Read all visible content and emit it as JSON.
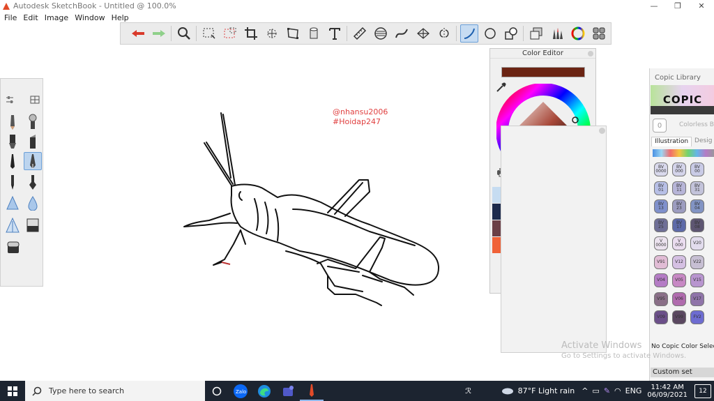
{
  "window": {
    "title": "Autodesk SketchBook - Untitled @ 100.0%",
    "minimize": "—",
    "maximize": "❐",
    "close": "✕"
  },
  "menu": [
    "File",
    "Edit",
    "Image",
    "Window",
    "Help"
  ],
  "toolbar": {
    "icons": [
      "undo-icon",
      "redo-icon",
      "zoom-icon",
      "select-icon",
      "lasso-icon",
      "crop-icon",
      "transform-icon",
      "distort-icon",
      "fill-icon",
      "text-icon",
      "ruler-icon",
      "ellipse-guide-icon",
      "french-curve-icon",
      "perspective-icon",
      "symmetry-icon",
      "line-icon",
      "circle-icon",
      "shape-icon",
      "layers-icon",
      "brush-library-icon",
      "color-wheel-icon",
      "copic-icon"
    ],
    "active": "line-icon"
  },
  "watermark": {
    "line1": "@nhansu2006",
    "line2": "#Hoidap247"
  },
  "color_editor": {
    "title": "Color Editor",
    "current_color": "#6b2413",
    "swatches": [
      "#c6dcf1",
      "#8fbdf0",
      "#2d86d6",
      "#1f4fa6",
      "#1a2d78",
      "#242e49",
      "#1c2a4c",
      "#ead8cc",
      "#f19ba0",
      "#e05d5e",
      "#b0424f",
      "#8e2b30",
      "#6b3f46",
      "#3a2627",
      "#3f5670",
      "#2ea39e",
      "#4d9b7a",
      "#f7ad3a",
      "#f06238",
      "#d2265c",
      "#6b2413"
    ]
  },
  "copic": {
    "title": "Copic Library",
    "logo": "COPIC",
    "colorless": "Colorless Ble",
    "tabs": [
      "Illustration",
      "Desig"
    ],
    "markers": [
      {
        "label": "BV\n0000",
        "color": "#d9d9ec"
      },
      {
        "label": "BV\n000",
        "color": "#d4d4ea"
      },
      {
        "label": "BV\n00",
        "color": "#c9cbe6"
      },
      {
        "label": "BV\n01",
        "color": "#b7bfe6"
      },
      {
        "label": "BV\n11",
        "color": "#b7b5d8"
      },
      {
        "label": "BV\n31",
        "color": "#c3c3da"
      },
      {
        "label": "BV\n13",
        "color": "#7f90cc"
      },
      {
        "label": "BV\n23",
        "color": "#9c9cc0"
      },
      {
        "label": "BV\n04",
        "color": "#8294c4"
      },
      {
        "label": "BV\n25",
        "color": "#6e6e96"
      },
      {
        "label": "BV\n17",
        "color": "#5d6aa9"
      },
      {
        "label": "BV\n08",
        "color": "#5e5672"
      },
      {
        "label": "V\n0000",
        "color": "#ebe2ee"
      },
      {
        "label": "V\n000",
        "color": "#eadcef"
      },
      {
        "label": "V20",
        "color": "#e2dced"
      },
      {
        "label": "V91",
        "color": "#e1bcd5"
      },
      {
        "label": "V12",
        "color": "#d5c0e3"
      },
      {
        "label": "V22",
        "color": "#c7bfd3"
      },
      {
        "label": "V04",
        "color": "#b47bc5"
      },
      {
        "label": "V05",
        "color": "#c788c4"
      },
      {
        "label": "V15",
        "color": "#b895cf"
      },
      {
        "label": "V95",
        "color": "#8a6f88"
      },
      {
        "label": "V06",
        "color": "#b06bae"
      },
      {
        "label": "V17",
        "color": "#8f74a9"
      },
      {
        "label": "V09",
        "color": "#6b4f89"
      },
      {
        "label": "V99",
        "color": "#5a4760"
      },
      {
        "label": "FV2",
        "color": "#6d6cd1"
      }
    ],
    "no_color_selected": "No Copic Color Selected",
    "custom_set": "Custom set"
  },
  "activate": {
    "line1": "Activate Windows",
    "line2": "Go to Settings to activate Windows."
  },
  "taskbar": {
    "search_placeholder": "Type here to search",
    "weather": "87°F  Light rain",
    "language": "ENG",
    "time": "11:42 AM",
    "date": "06/09/2021",
    "notifications": "12"
  }
}
